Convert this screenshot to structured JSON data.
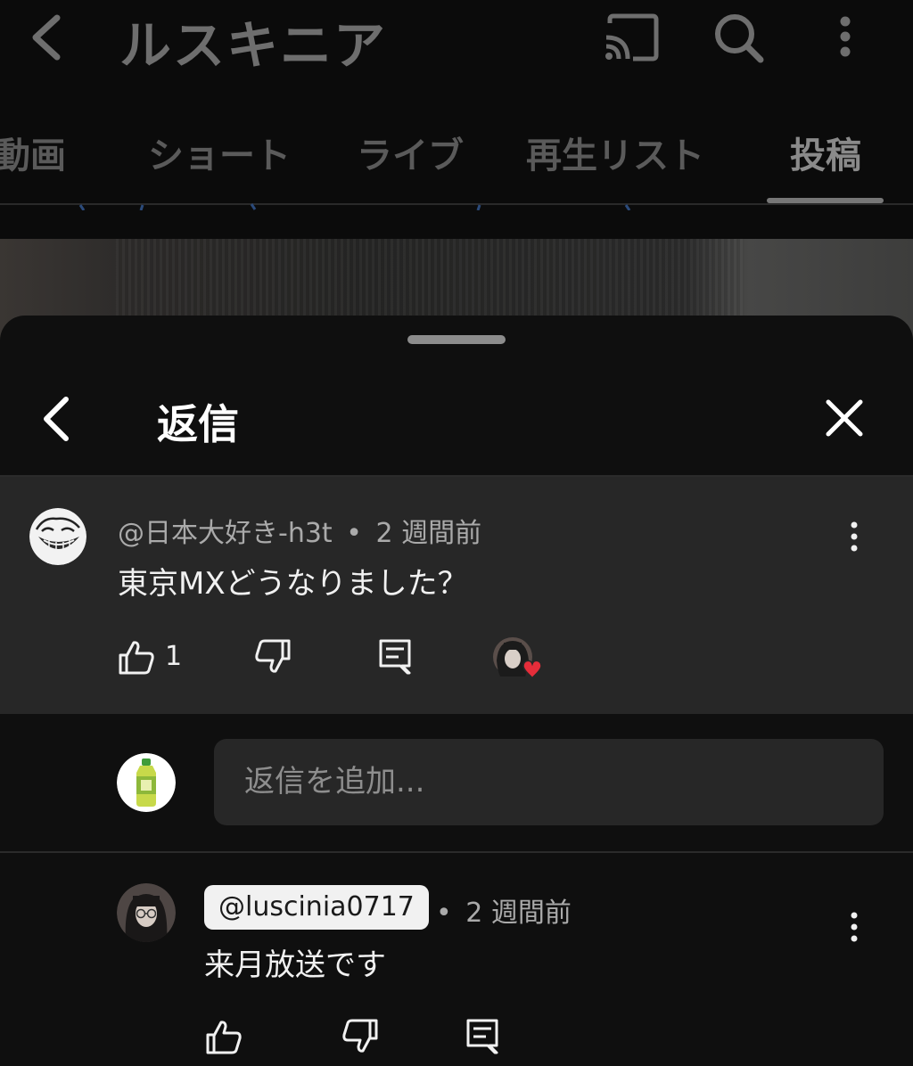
{
  "header": {
    "channel_title": "ルスキニア"
  },
  "tabs": [
    {
      "label": "動画",
      "active": false
    },
    {
      "label": "ショート",
      "active": false
    },
    {
      "label": "ライブ",
      "active": false
    },
    {
      "label": "再生リスト",
      "active": false
    },
    {
      "label": "投稿",
      "active": true
    }
  ],
  "sheet": {
    "title": "返信"
  },
  "comment": {
    "author": "@日本大好き-h3t",
    "separator": "•",
    "time": "2 週間前",
    "text": "東京MXどうなりました？",
    "like_count": "1"
  },
  "reply_box": {
    "placeholder": "返信を追加..."
  },
  "reply": {
    "author": "@luscinia0717",
    "separator": "•",
    "time": "2 週間前",
    "text": "来月放送です"
  },
  "colors": {
    "background": "#0f0f0f",
    "comment_highlight": "#272727",
    "heart": "#e52d3a"
  }
}
